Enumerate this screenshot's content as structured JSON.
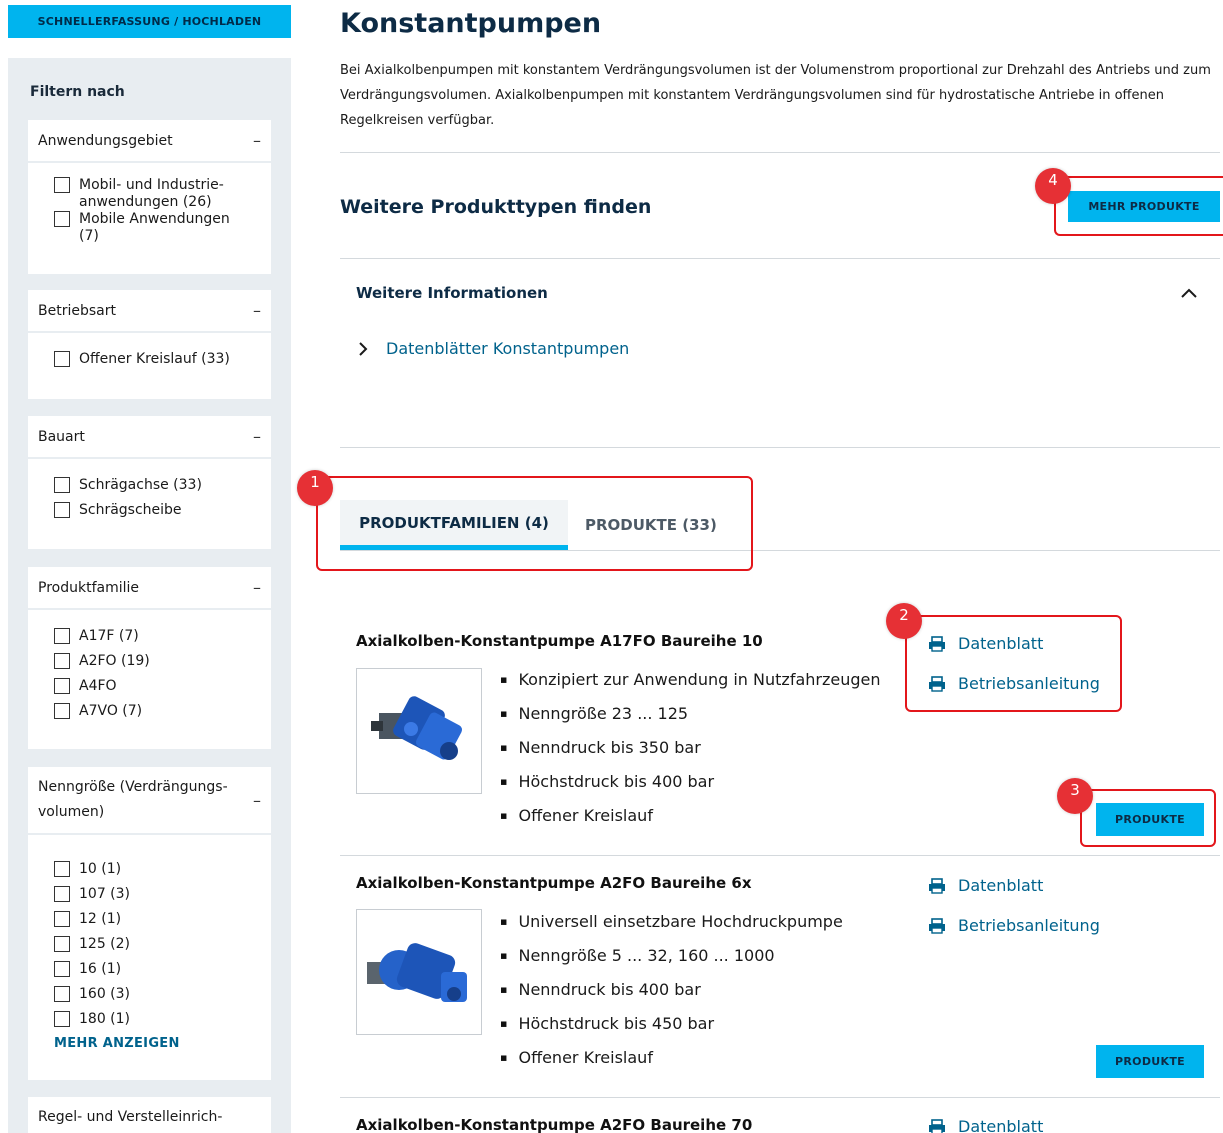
{
  "sidebar": {
    "quick_button": "SCHNELLERFASSUNG / HOCHLADEN",
    "filter_title": "Filtern nach",
    "groups": [
      {
        "title": "Anwendungsgebiet",
        "options": [
          "Mobil- und Industrie-\nanwendungen (26)",
          "Mobile Anwendungen\n(7)"
        ]
      },
      {
        "title": "Betriebsart",
        "options": [
          "Offener Kreislauf (33)"
        ]
      },
      {
        "title": "Bauart",
        "options": [
          "Schrägachse (33)",
          "Schrägscheibe"
        ]
      },
      {
        "title": "Produktfamilie",
        "options": [
          "A17F (7)",
          "A2FO (19)",
          "A4FO",
          "A7VO (7)"
        ]
      },
      {
        "title": "Nenngröße (Verdrängungs-\nvolumen)",
        "options": [
          "10 (1)",
          "107 (3)",
          "12 (1)",
          "125 (2)",
          "16 (1)",
          "160 (3)",
          "180 (1)"
        ],
        "more": "MEHR ANZEIGEN"
      },
      {
        "title": "Regel- und Verstelleinrich-"
      }
    ],
    "collapse_symbol": "–"
  },
  "main": {
    "title": "Konstantpumpen",
    "intro": "Bei Axialkolbenpumpen mit konstantem Verdrängungsvolumen ist der Volumenstrom proportional zur Drehzahl des Antriebs und zum Verdrängungsvolumen. Axialkolbenpumpen mit konstantem Verdrängungsvolumen sind für hydrostatische Antriebe in offenen Regelkreisen verfügbar.",
    "more_types_heading": "Weitere Produkttypen finden",
    "more_products_button": "MEHR PRODUKTE",
    "info_heading": "Weitere Informationen",
    "datasheet_link": "Datenblätter Konstantpumpen",
    "tabs": [
      {
        "label": "PRODUKTFAMILIEN (4)",
        "active": true
      },
      {
        "label": "PRODUKTE (33)",
        "active": false
      }
    ],
    "products": [
      {
        "title": "Axialkolben-Konstantpumpe A17FO Baureihe 10",
        "features": [
          "Konzipiert zur Anwendung in Nutzfahrzeugen",
          "Nenngröße 23 ... 125",
          "Nenndruck bis 350 bar",
          "Höchstdruck bis 400 bar",
          "Offener Kreislauf"
        ],
        "datasheet": "Datenblatt",
        "manual": "Betriebsanleitung",
        "button": "PRODUKTE"
      },
      {
        "title": "Axialkolben-Konstantpumpe A2FO Baureihe 6x",
        "features": [
          "Universell einsetzbare Hochdruckpumpe",
          "Nenngröße 5 ... 32, 160 ... 1000",
          "Nenndruck bis 400 bar",
          "Höchstdruck bis 450 bar",
          "Offener Kreislauf"
        ],
        "datasheet": "Datenblatt",
        "manual": "Betriebsanleitung",
        "button": "PRODUKTE"
      },
      {
        "title": "Axialkolben-Konstantpumpe A2FO Baureihe 70",
        "datasheet": "Datenblatt"
      }
    ]
  },
  "annotations": [
    "1",
    "2",
    "3",
    "4"
  ],
  "colors": {
    "accent": "#00b4ee",
    "link": "#00628c",
    "heading": "#0d2b45",
    "annotation": "#e3161b",
    "sidebar_bg": "#e8edf1"
  }
}
